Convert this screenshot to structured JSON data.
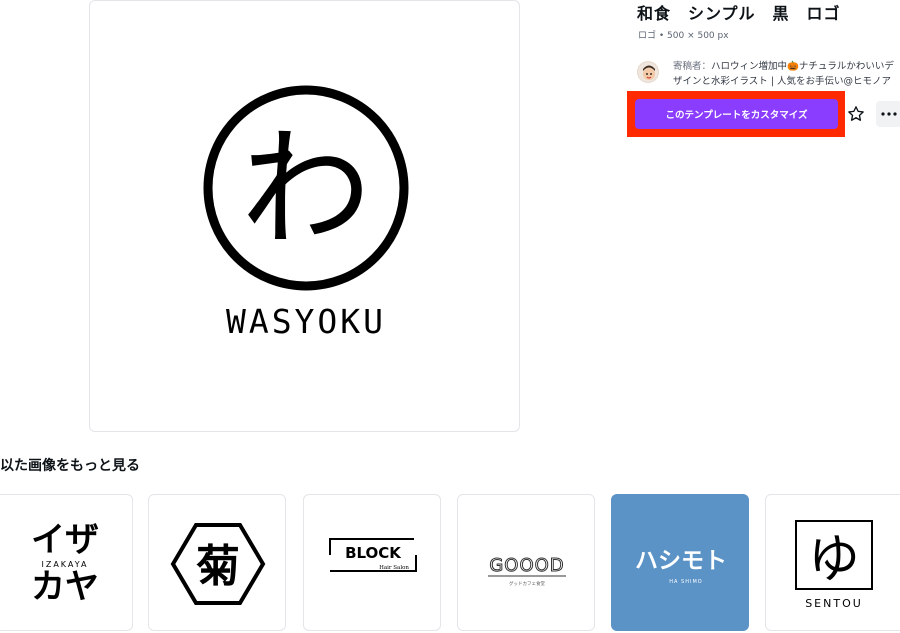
{
  "template": {
    "title": "和食　シンプル　黒　ロゴ",
    "meta": "ロゴ • 500 × 500 px",
    "contributor_label": "寄稿者：",
    "contributor_name": "ハロウィン増加中🎃ナチュラルかわいいデザインと水彩イラスト | 人気をお手伝い@ヒモノア",
    "customize_button": "このテンプレートをカスタマイズ",
    "logo_glyph": "わ",
    "logo_text": "WASYOKU"
  },
  "similar": {
    "heading": "以た画像をもっと見る",
    "items": [
      {
        "name": "izakaya",
        "line1": "イザ",
        "sub": "IZAKAYA",
        "line2": "カヤ"
      },
      {
        "name": "kiku",
        "glyph": "菊"
      },
      {
        "name": "block",
        "text": "BLOCK",
        "sub": "Hair Salon"
      },
      {
        "name": "goood",
        "text": "GOOOD",
        "sub": "グッドカフェ食堂"
      },
      {
        "name": "hashimoto",
        "text": "ハシモト",
        "sub": "HA SHIMO",
        "bg": "#5b93c7"
      },
      {
        "name": "sentou",
        "glyph": "ゆ",
        "text": "SENTOU"
      }
    ]
  },
  "colors": {
    "accent": "#8b3dff",
    "highlight": "#ff2a00"
  },
  "icons": [
    "star-icon",
    "more-icon"
  ]
}
